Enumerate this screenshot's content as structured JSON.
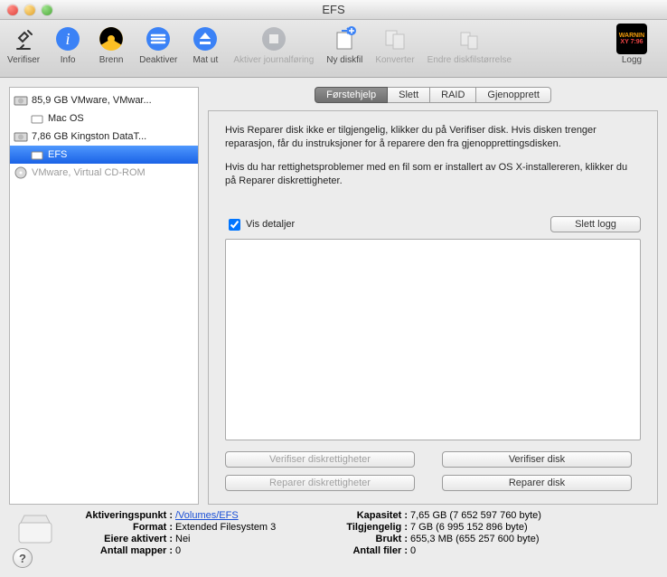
{
  "window": {
    "title": "EFS"
  },
  "toolbar": {
    "items": [
      {
        "id": "verify",
        "label": "Verifiser"
      },
      {
        "id": "info",
        "label": "Info"
      },
      {
        "id": "burn",
        "label": "Brenn"
      },
      {
        "id": "deact",
        "label": "Deaktiver"
      },
      {
        "id": "eject",
        "label": "Mat ut"
      },
      {
        "id": "journal",
        "label": "Aktiver journalføring",
        "disabled": true
      },
      {
        "id": "newimg",
        "label": "Ny diskfil"
      },
      {
        "id": "convert",
        "label": "Konverter",
        "disabled": true
      },
      {
        "id": "resize",
        "label": "Endre diskfilstørrelse",
        "disabled": true
      },
      {
        "id": "log",
        "label": "Logg"
      }
    ]
  },
  "sidebar": {
    "items": [
      {
        "kind": "disk",
        "label": "85,9 GB VMware, VMwar..."
      },
      {
        "kind": "volume",
        "label": "Mac OS",
        "child": true
      },
      {
        "kind": "disk",
        "label": "7,86 GB Kingston DataT..."
      },
      {
        "kind": "volume",
        "label": "EFS",
        "child": true,
        "selected": true
      },
      {
        "kind": "optical",
        "label": "VMware, Virtual CD-ROM",
        "dim": true
      }
    ]
  },
  "tabs": {
    "items": [
      {
        "id": "firstaid",
        "label": "Førstehjelp",
        "active": true
      },
      {
        "id": "erase",
        "label": "Slett"
      },
      {
        "id": "raid",
        "label": "RAID"
      },
      {
        "id": "restore",
        "label": "Gjenopprett"
      }
    ]
  },
  "firstaid": {
    "para1": "Hvis Reparer disk ikke er tilgjengelig, klikker du på Verifiser disk. Hvis disken trenger reparasjon, får du instruksjoner for å reparere den fra gjenopprettingsdisken.",
    "para2": "Hvis du har rettighetsproblemer med en fil som er installert av OS X-installereren, klikker du på Reparer diskrettigheter.",
    "show_details_label": "Vis detaljer",
    "show_details_checked": true,
    "clear_log_label": "Slett logg",
    "buttons": {
      "verify_perms": "Verifiser diskrettigheter",
      "verify_disk": "Verifiser disk",
      "repair_perms": "Reparer diskrettigheter",
      "repair_disk": "Reparer disk"
    },
    "perms_enabled": false
  },
  "info": {
    "keys": {
      "mount": "Aktiveringspunkt",
      "format": "Format",
      "owners": "Eiere aktivert",
      "folders": "Antall mapper",
      "capacity": "Kapasitet",
      "avail": "Tilgjengelig",
      "used": "Brukt",
      "files": "Antall filer"
    },
    "values": {
      "mount": "/Volumes/EFS",
      "format": "Extended Filesystem 3",
      "owners": "Nei",
      "folders": "0",
      "capacity": "7,65 GB (7 652 597 760 byte)",
      "avail": "7 GB (6 995 152 896 byte)",
      "used": "655,3 MB (655 257 600 byte)",
      "files": "0"
    }
  },
  "log_badge": {
    "line1": "WARNIN",
    "line2": "XY 7:96"
  }
}
